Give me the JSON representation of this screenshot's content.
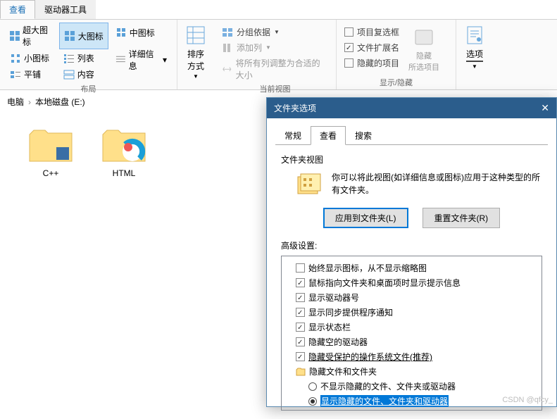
{
  "ribbon_tabs": {
    "view": "查看",
    "drive_tools": "驱动器工具"
  },
  "layout": {
    "extra_large": "超大图标",
    "large": "大图标",
    "medium": "中图标",
    "small": "小图标",
    "list": "列表",
    "details": "详细信息",
    "tiles": "平铺",
    "content": "内容",
    "group_label": "布局"
  },
  "sort": {
    "button": "排序方式"
  },
  "current_view": {
    "group_by": "分组依据",
    "add_columns": "添加列",
    "fit_columns": "将所有列调整为合适的大小",
    "group_label": "当前视图"
  },
  "show_hide": {
    "item_checkboxes": "项目复选框",
    "file_ext": "文件扩展名",
    "hidden_items": "隐藏的项目",
    "hide_selected": "隐藏\n所选项目",
    "group_label": "显示/隐藏"
  },
  "options": {
    "button": "选项"
  },
  "breadcrumb": {
    "pc": "电脑",
    "drive": "本地磁盘 (E:)"
  },
  "files": {
    "cpp": "C++",
    "html": "HTML"
  },
  "dialog": {
    "title": "文件夹选项",
    "tabs": {
      "general": "常规",
      "view": "查看",
      "search": "搜索"
    },
    "folder_views": "文件夹视图",
    "fv_text": "你可以将此视图(如详细信息或图标)应用于这种类型的所有文件夹。",
    "apply_btn": "应用到文件夹(L)",
    "reset_btn": "重置文件夹(R)",
    "advanced": "高级设置:",
    "items": {
      "always_icons": "始终显示图标，从不显示缩略图",
      "tooltips": "鼠标指向文件夹和桌面项时显示提示信息",
      "drive_letters": "显示驱动器号",
      "sync_notif": "显示同步提供程序通知",
      "status_bar": "显示状态栏",
      "hide_empty": "隐藏空的驱动器",
      "hide_protected": "隐藏受保护的操作系统文件(推荐)",
      "hidden_folder": "隐藏文件和文件夹",
      "dont_show": "不显示隐藏的文件、文件夹或驱动器",
      "show_hidden": "显示隐藏的文件、文件夹和驱动器"
    }
  },
  "watermark": "CSDN @qfcy_"
}
